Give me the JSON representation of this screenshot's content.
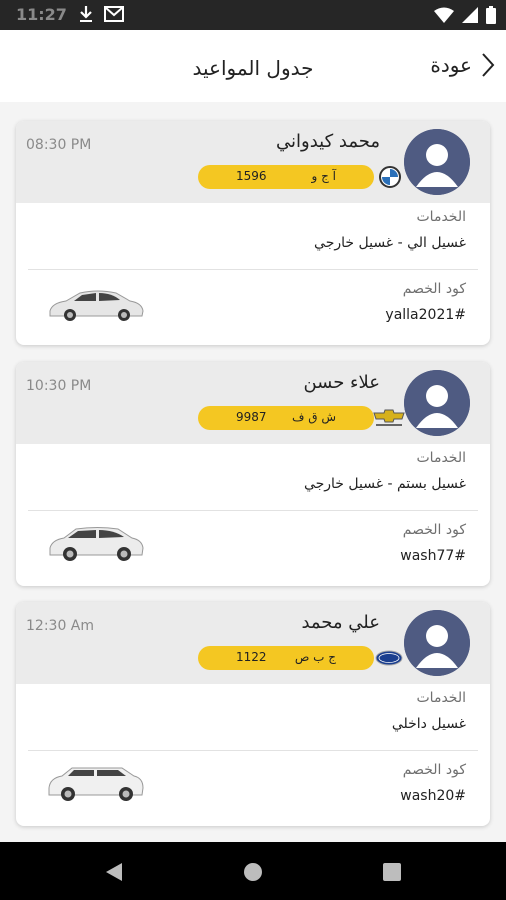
{
  "status": {
    "time": "11:27"
  },
  "header": {
    "title": "جدول المواعيد",
    "back_label": "عودة"
  },
  "sections": {
    "services_label": "الخدمات",
    "discount_label": "كود الخصم"
  },
  "appointments": [
    {
      "name": "محمد كيدواني",
      "time": "08:30 PM",
      "plate_letters": "آ ج و",
      "plate_number": "1596",
      "brand_icon": "bmw-logo",
      "services": "غسيل الي - غسيل خارجي",
      "discount": "yalla2021#",
      "car_icon": "sedan-car"
    },
    {
      "name": "علاء حسن",
      "time": "10:30 PM",
      "plate_letters": "ش ق ف",
      "plate_number": "9987",
      "brand_icon": "chevrolet-logo",
      "services": "غسيل بستم - غسيل خارجي",
      "discount": "wash77#",
      "car_icon": "suv-car"
    },
    {
      "name": "علي محمد",
      "time": "12:30 Am",
      "plate_letters": "ج ب ص",
      "plate_number": "1122",
      "brand_icon": "ford-logo",
      "services": "غسيل داخلي",
      "discount": "wash20#",
      "car_icon": "large-suv-car"
    }
  ],
  "colors": {
    "plate": "#f4c722",
    "avatar": "#4f5b82",
    "card_top": "#ebebeb"
  }
}
